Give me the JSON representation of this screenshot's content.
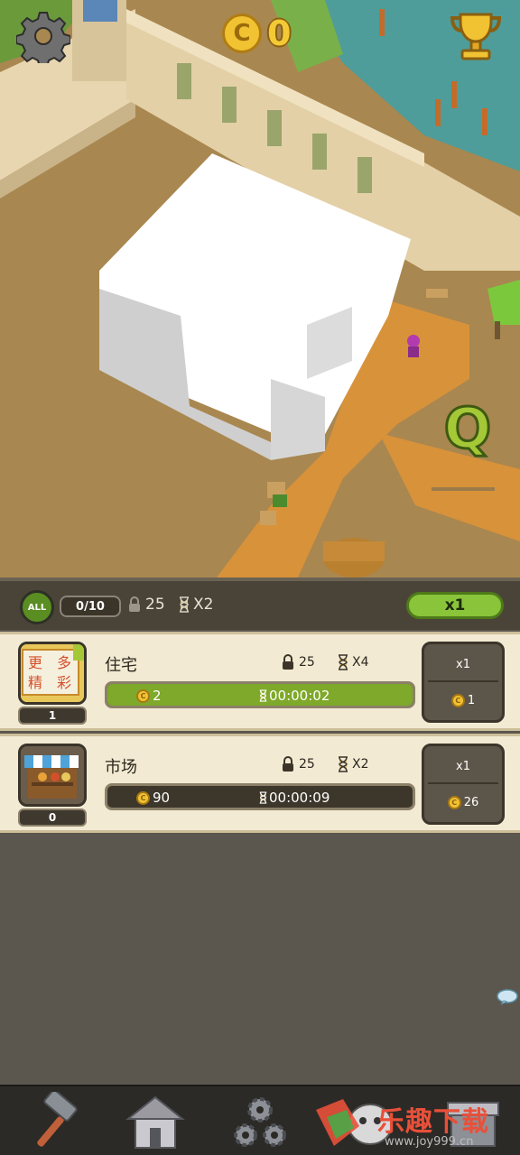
{
  "hud": {
    "coins": "0",
    "coin_symbol": "C",
    "settings_icon": "gear-icon",
    "achievements_icon": "trophy-icon"
  },
  "scene": {
    "badge_letter": "Q"
  },
  "status_bar": {
    "filter_label": "ALL",
    "capacity": "0/10",
    "lock_value": "25",
    "speed_value": "X2",
    "multiplier_label": "x1"
  },
  "buildings": [
    {
      "name": "住宅",
      "sign_text": [
        "更",
        "多",
        "精",
        "彩"
      ],
      "level": "1",
      "lock_value": "25",
      "speed_value": "X4",
      "income": "2",
      "timer": "00:00:02",
      "progress": 1.0,
      "upgrade_multiplier": "x1",
      "upgrade_cost": "1"
    },
    {
      "name": "市场",
      "level": "0",
      "lock_value": "25",
      "speed_value": "X2",
      "income": "90",
      "timer": "00:00:09",
      "progress": 0,
      "upgrade_multiplier": "x1",
      "upgrade_cost": "26"
    }
  ],
  "nav": [
    {
      "icon": "hammer-icon"
    },
    {
      "icon": "house-icon"
    },
    {
      "icon": "gears-icon"
    },
    {
      "icon": "monster-icon"
    },
    {
      "icon": "shop-icon"
    }
  ],
  "watermark": {
    "text": "乐趣下载",
    "url": "www.joy999.cn"
  },
  "colors": {
    "accent_green": "#8ac43a",
    "coin_gold": "#f1c232",
    "panel_cream": "#f2ead2",
    "panel_dark": "#4a4438"
  }
}
